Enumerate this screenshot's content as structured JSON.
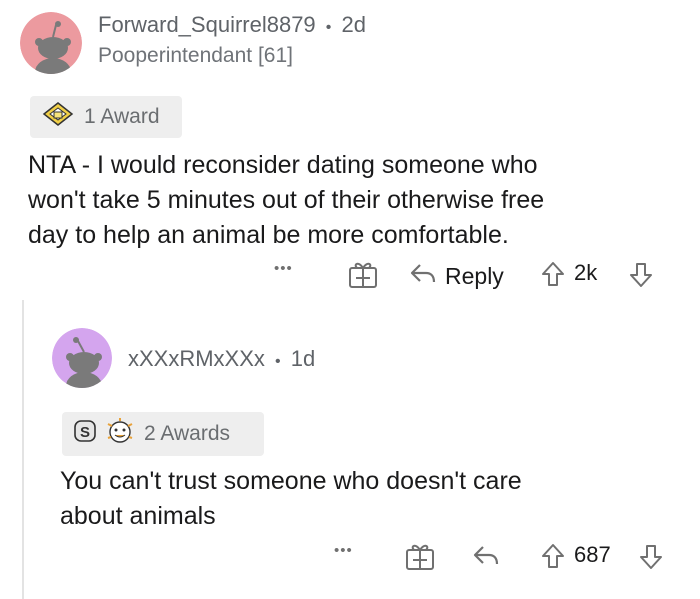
{
  "comments": [
    {
      "username": "Forward_Squirrel8879",
      "separator": "•",
      "age": "2d",
      "flair": "Pooperintendant [61]",
      "awards_label": "1 Award",
      "body_lines": [
        "NTA - I would reconsider dating someone who",
        "won't take 5 minutes out of their otherwise free",
        "day to help an animal be more comfortable."
      ],
      "more_label": "•••",
      "reply_label": "Reply",
      "score": "2k",
      "avatar_color": "#ec9a9f"
    },
    {
      "username": "xXXxRMxXXx",
      "separator": "•",
      "age": "1d",
      "awards_label": "2 Awards",
      "body_lines": [
        "You can't trust someone who doesn't care",
        "about animals"
      ],
      "more_label": "•••",
      "score": "687",
      "avatar_color": "#d4a5ee"
    }
  ],
  "icons": {
    "gift": "gift-icon",
    "reply": "reply-arrow-icon",
    "upvote": "upvote-arrow-icon",
    "downvote": "downvote-arrow-icon",
    "award_helpful": "helpful-award-icon",
    "award_silver": "silver-award-icon",
    "award_wholesome": "wholesome-award-icon"
  },
  "colors": {
    "muted_text": "#707070",
    "thread_line": "#e3e3e3",
    "award_bg": "#eeeeee"
  }
}
